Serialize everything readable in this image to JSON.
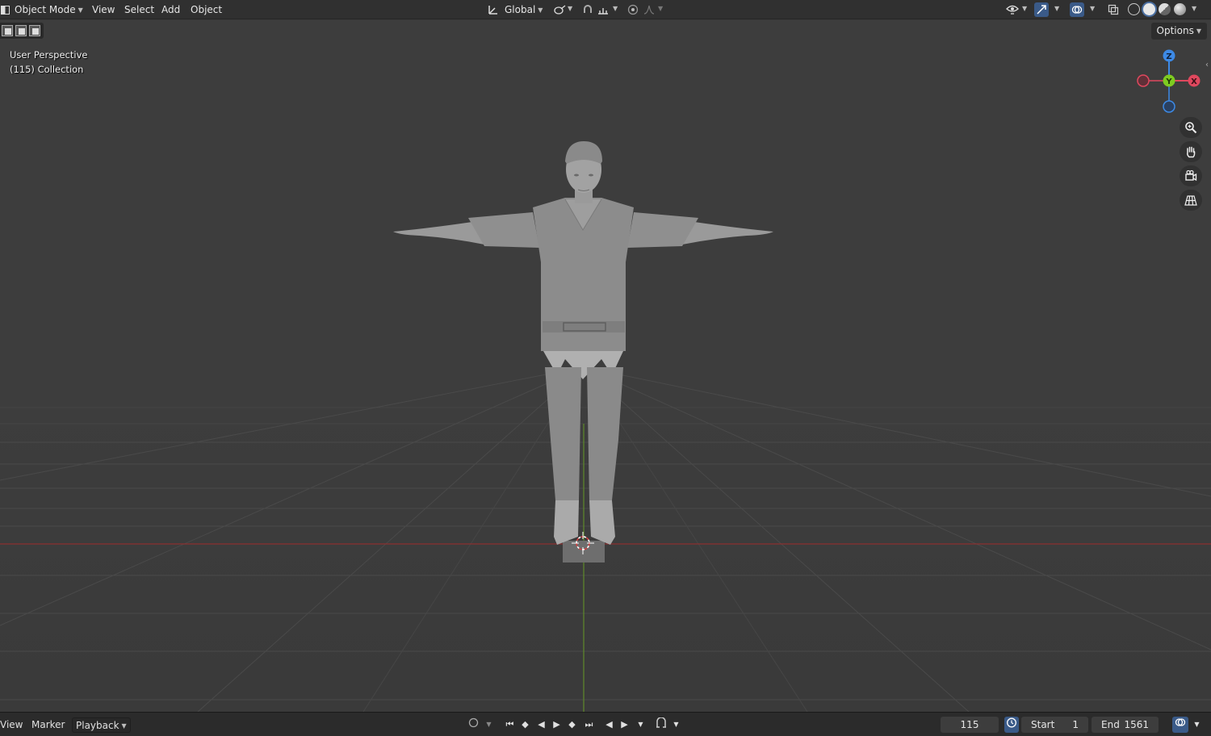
{
  "header": {
    "mode_dropdown": "Object Mode",
    "menus": [
      "View",
      "Select",
      "Add",
      "Object"
    ],
    "transform_orientation": "Global",
    "options_label": "Options"
  },
  "viewport": {
    "perspective_label": "User Perspective",
    "collection_label": "(115) Collection",
    "gizmo_axes": {
      "z": "Z",
      "y": "Y",
      "x": "X"
    },
    "axis_colors": {
      "x": "#e0485e",
      "y": "#7ecb20",
      "z": "#3d8ae6"
    }
  },
  "icons": {
    "nav_tools": [
      "zoom-icon",
      "hand-pan-icon",
      "camera-icon",
      "grid-view-icon"
    ]
  },
  "timeline": {
    "menus": [
      "View",
      "Marker"
    ],
    "playback_dropdown": "Playback",
    "current_frame": "115",
    "start_label": "Start",
    "start_value": "1",
    "end_label": "End",
    "end_value": "1561"
  }
}
